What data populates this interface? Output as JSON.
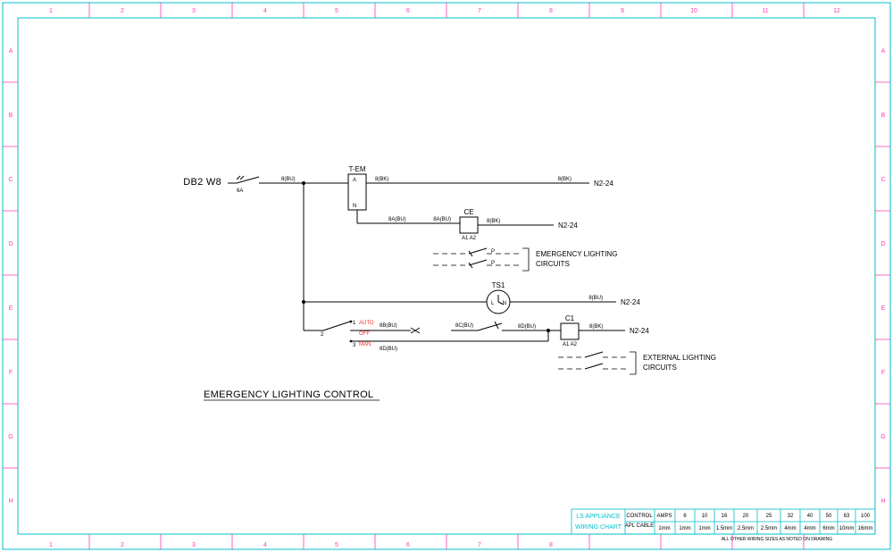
{
  "grid": {
    "cols": [
      "1",
      "2",
      "3",
      "4",
      "5",
      "6",
      "7",
      "8",
      "9",
      "10",
      "11",
      "12"
    ],
    "rows": [
      "A",
      "B",
      "C",
      "D",
      "E",
      "F",
      "G",
      "H"
    ]
  },
  "source": "DB2 W8",
  "source_rating": "6A",
  "wires": {
    "w1": "8(BU)",
    "w2": "8(BK)",
    "w3": "8(BK)",
    "w4": "8A(BU)",
    "w5": "8A(BU)",
    "w6": "8(BK)",
    "w7": "8(BU)",
    "w8a": "8B(BU)",
    "w8b": "8C(BU)",
    "w9": "8D(BU)",
    "w10": "8(BK)",
    "w11": "8D(BU)"
  },
  "labels": {
    "tem": "T-EM",
    "tem_a": "A",
    "tem_n": "N",
    "ce": "CE",
    "ce_a1": "A1",
    "ce_a2": "A2",
    "ts1": "TS1",
    "ts_l": "L",
    "ts_n": "N",
    "c1": "C1",
    "c1_a1": "A1",
    "c1_a2": "A2",
    "p": "P",
    "sw1": "1",
    "sw2": "2",
    "sw3": "3",
    "auto": "AUTO",
    "off": "OFF",
    "man": "MAN",
    "n224": "N2-24",
    "em_circ": "EMERGENCY LIGHTING",
    "em_circ2": "CIRCUITS",
    "ext_circ": "EXTERNAL LIGHTING",
    "ext_circ2": "CIRCUITS",
    "title": "EMERGENCY LIGHTING CONTROL"
  },
  "table": {
    "title1": "LS APPLIANCE",
    "title2": "WIRING CHART",
    "row1_head": "CONTROL",
    "row2_head": "APL CABLE",
    "amps_head": "AMPS",
    "control_val": "1mm",
    "amps": [
      "6",
      "10",
      "16",
      "20",
      "25",
      "32",
      "40",
      "50",
      "63",
      "100"
    ],
    "cable": [
      "1mm",
      "1mm",
      "1.5mm",
      "2.5mm",
      "2.5mm",
      "4mm",
      "4mm",
      "6mm",
      "10mm",
      "16mm"
    ],
    "footnote": "ALL OTHER WIRING SIZES AS NOTED ON DRAWING"
  }
}
